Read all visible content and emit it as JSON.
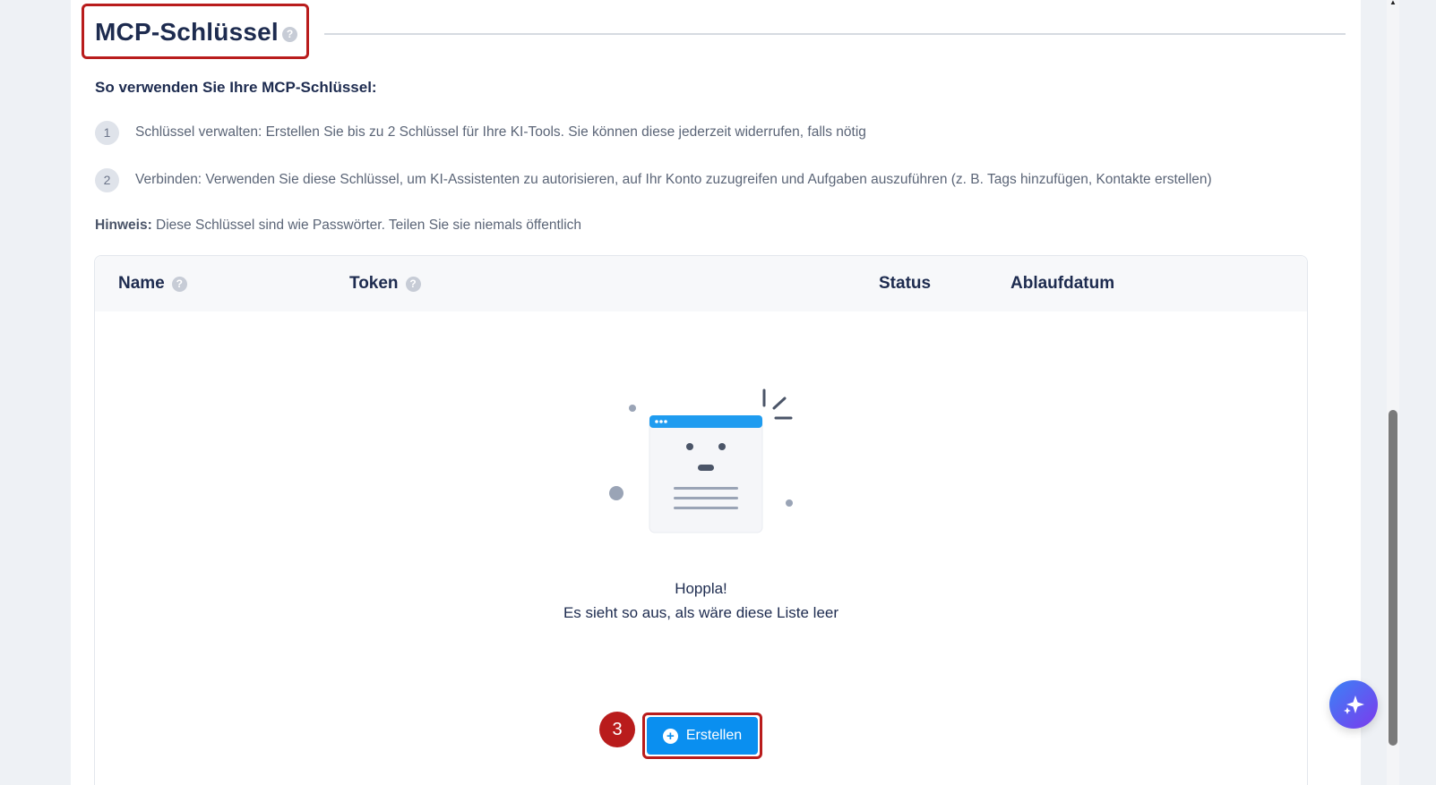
{
  "header": {
    "title": "MCP-Schlüssel",
    "help_glyph": "?"
  },
  "instructions": {
    "heading": "So verwenden Sie Ihre MCP-Schlüssel:",
    "steps": [
      {
        "number": "1",
        "text": "Schlüssel verwalten: Erstellen Sie bis zu 2 Schlüssel für Ihre KI-Tools. Sie können diese jederzeit widerrufen, falls nötig"
      },
      {
        "number": "2",
        "text": "Verbinden: Verwenden Sie diese Schlüssel, um KI-Assistenten zu autorisieren, auf Ihr Konto zuzugreifen und Aufgaben auszuführen (z. B. Tags hinzufügen, Kontakte erstellen)"
      }
    ],
    "note_label": "Hinweis:",
    "note_text": " Diese Schlüssel sind wie Passwörter. Teilen Sie sie niemals öffentlich"
  },
  "table": {
    "columns": [
      "Name",
      "Token",
      "Status",
      "Ablaufdatum"
    ]
  },
  "empty_state": {
    "title": "Hoppla!",
    "subtitle": "Es sieht so aus, als wäre diese Liste leer"
  },
  "actions": {
    "create_label": "Erstellen",
    "step_marker": "3"
  },
  "icons": {
    "help": "question-circle-icon",
    "plus": "plus-circle-icon",
    "ai": "sparkle-icon"
  },
  "colors": {
    "primary": "#0a8ff0",
    "highlight": "#b91c1c",
    "text": "#1d2b4f"
  }
}
